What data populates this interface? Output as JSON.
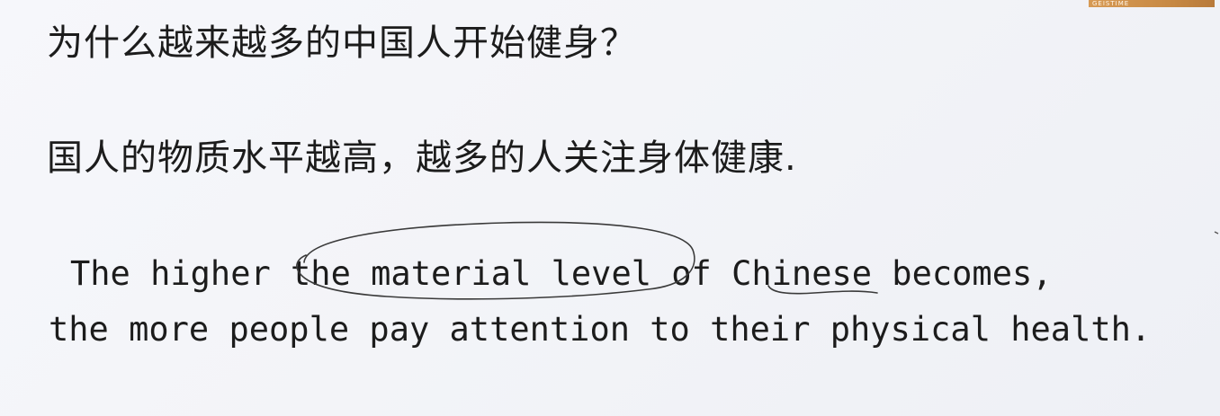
{
  "slide": {
    "watermark": "GEISTIME",
    "question": "为什么越来越多的中国人开始健身？",
    "answer_zh": "国人的物质水平越高，越多的人关注身体健康.",
    "answer_en_line1": "The higher the material level of Chinese becomes,",
    "answer_en_line2": "the more people pay attention to their physical health."
  },
  "annotations": {
    "circle_target": "the material level",
    "underline_target": "Chinese",
    "ink_color": "#3a3a3a"
  }
}
